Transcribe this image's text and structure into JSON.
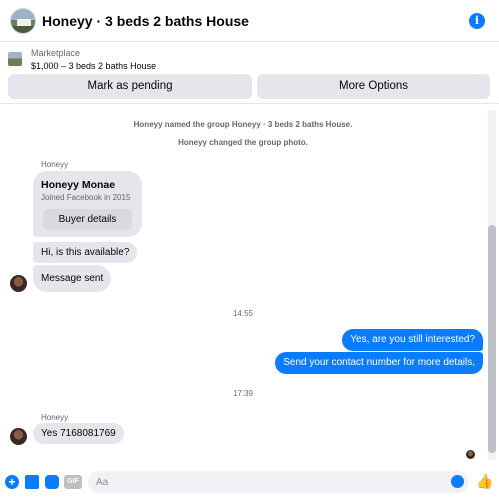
{
  "header": {
    "title": "Honeyy · 3 beds 2 baths House",
    "info_icon": "info-icon"
  },
  "marketplace": {
    "label": "Marketplace",
    "listing": "$1,000 – 3 beds 2 baths House",
    "mark_pending_label": "Mark as pending",
    "more_options_label": "More Options"
  },
  "chat": {
    "system_messages": [
      "Honeyy named the group Honeyy · 3 beds 2 baths House.",
      "Honeyy changed the group photo."
    ],
    "sender_name": "Honeyy",
    "buyer_card": {
      "name": "Honeyy Monae",
      "joined": "Joined Facebook in 2015",
      "button_label": "Buyer details"
    },
    "incoming_1": "Hi, is this available?",
    "incoming_2": "Message sent",
    "time_1": "14:55",
    "outgoing_1": "Yes, are you still interested?",
    "outgoing_2": "Send your contact number for more details,",
    "time_2": "17:39",
    "sender_name_2": "Honeyy",
    "incoming_3": "Yes 7168081769"
  },
  "composer": {
    "placeholder": "Aa",
    "gif_label": "GIF"
  },
  "colors": {
    "accent": "#0a7cff",
    "bubble_in": "#e4e6eb",
    "button_gray": "#e4e6eb"
  }
}
